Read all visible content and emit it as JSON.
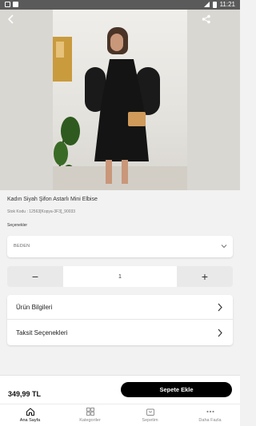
{
  "status_bar": {
    "time": "11:21"
  },
  "product": {
    "title": "Kadın Siyah Şifon Astarlı Mini Elbise",
    "sku": "Stok Kodu : 12563[Kopya-3F3]_90033",
    "options_label": "Seçenekler",
    "size_select": {
      "placeholder": "BEDEN"
    },
    "quantity": "1",
    "decrement_symbol": "−",
    "increment_symbol": "+",
    "sections": [
      {
        "label": "Ürün Bilgileri"
      },
      {
        "label": "Taksit Seçenekleri"
      }
    ]
  },
  "cart_bar": {
    "price": "349,99 TL",
    "add_to_cart": "Sepete Ekle"
  },
  "tabbar": {
    "items": [
      {
        "label": "Ana Sayfa",
        "icon": "home-icon",
        "active": true
      },
      {
        "label": "Kategoriler",
        "icon": "grid-icon",
        "active": false
      },
      {
        "label": "Sepetim",
        "icon": "cart-icon",
        "active": false
      },
      {
        "label": "Daha Fazla",
        "icon": "more-icon",
        "active": false
      }
    ]
  },
  "colors": {
    "primary_button": "#000000",
    "background": "#f2f2f2"
  }
}
